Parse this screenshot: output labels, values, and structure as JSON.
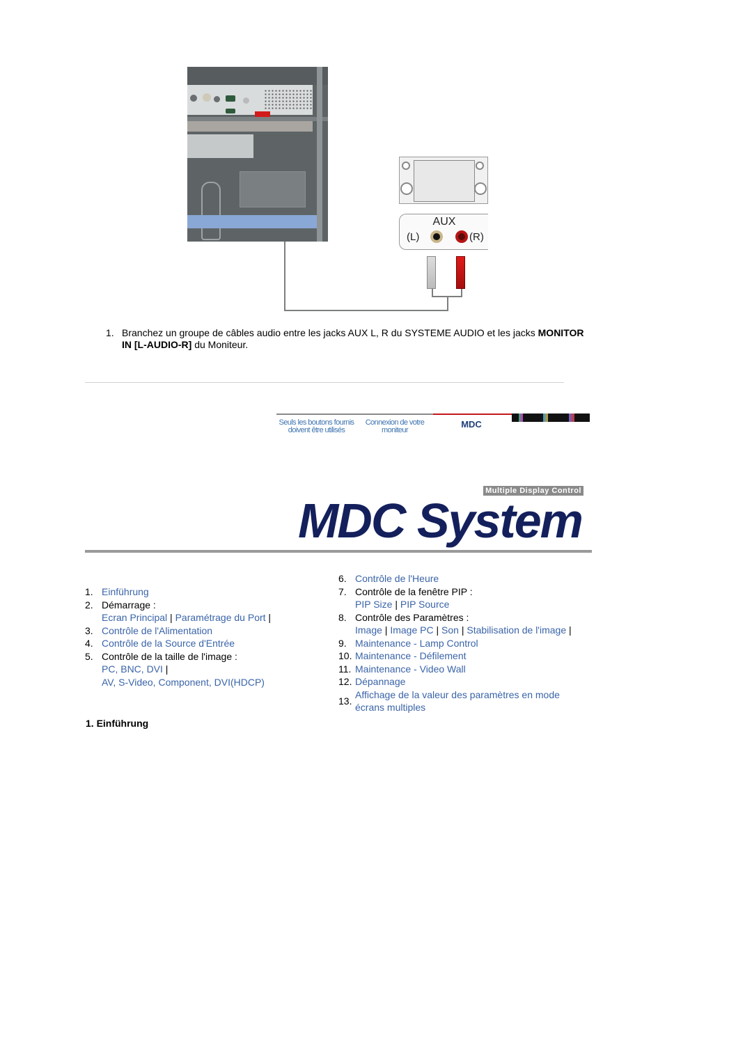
{
  "figure": {
    "aux_panel": {
      "title": "AUX",
      "left_label": "(L)",
      "right_label": "(R)"
    }
  },
  "instructions": [
    {
      "number": "1.",
      "text_before": "Branchez un groupe de câbles audio entre les jacks AUX L, R du SYSTEME AUDIO et les jacks ",
      "bold": "MONITOR IN [L-AUDIO-R]",
      "text_after": " du Moniteur."
    }
  ],
  "nav_banner": {
    "items": [
      {
        "label": "Seuls les boutons fournis doivent être utilisés",
        "color": "#3e74b0"
      },
      {
        "label": "Connexion de votre moniteur",
        "color": "#3e74b0"
      },
      {
        "label": "MDC",
        "color": "#1f3f77",
        "active": true
      }
    ],
    "active_accent": "#c4161c"
  },
  "logo": {
    "subtitle": "Multiple Display Control",
    "title": "MDC System"
  },
  "toc": {
    "left": [
      {
        "num": "1.",
        "links": [
          "Einführung"
        ]
      },
      {
        "num": "2.",
        "label": "Démarrage :",
        "links": [
          "Ecran Principal",
          "Paramétrage du Port"
        ],
        "trailing_sep": true
      },
      {
        "num": "3.",
        "links": [
          "Contrôle de l'Alimentation"
        ]
      },
      {
        "num": "4.",
        "links": [
          "Contrôle de la Source d'Entrée"
        ]
      },
      {
        "num": "5.",
        "label": "Contrôle de la taille de l'image :",
        "link_lines": [
          [
            "PC, BNC, DVI"
          ],
          [
            "AV, S-Video, Component, DVI(HDCP)"
          ]
        ]
      }
    ],
    "right": [
      {
        "num": "6.",
        "links": [
          "Contrôle de l'Heure"
        ]
      },
      {
        "num": "7.",
        "label": "Contrôle de la fenêtre PIP :",
        "links": [
          "PIP Size",
          "PIP Source"
        ]
      },
      {
        "num": "8.",
        "label": "Contrôle des Paramètres :",
        "links": [
          "Image",
          "Image PC",
          "Son",
          "Stabilisation de l'image"
        ],
        "trailing_sep": true
      },
      {
        "num": "9.",
        "links": [
          "Maintenance - Lamp Control"
        ]
      },
      {
        "num": "10.",
        "links": [
          "Maintenance - Défilement"
        ]
      },
      {
        "num": "11.",
        "links": [
          "Maintenance - Video Wall"
        ]
      },
      {
        "num": "12.",
        "links": [
          "Dépannage"
        ]
      },
      {
        "num": "13.",
        "links": [
          "Affichage de la valeur des paramètres en mode",
          "écrans multiples"
        ]
      }
    ]
  },
  "section": {
    "heading": "1. Einführung"
  },
  "colors": {
    "link": "#3a64a8",
    "logo_text": "#14205c"
  }
}
